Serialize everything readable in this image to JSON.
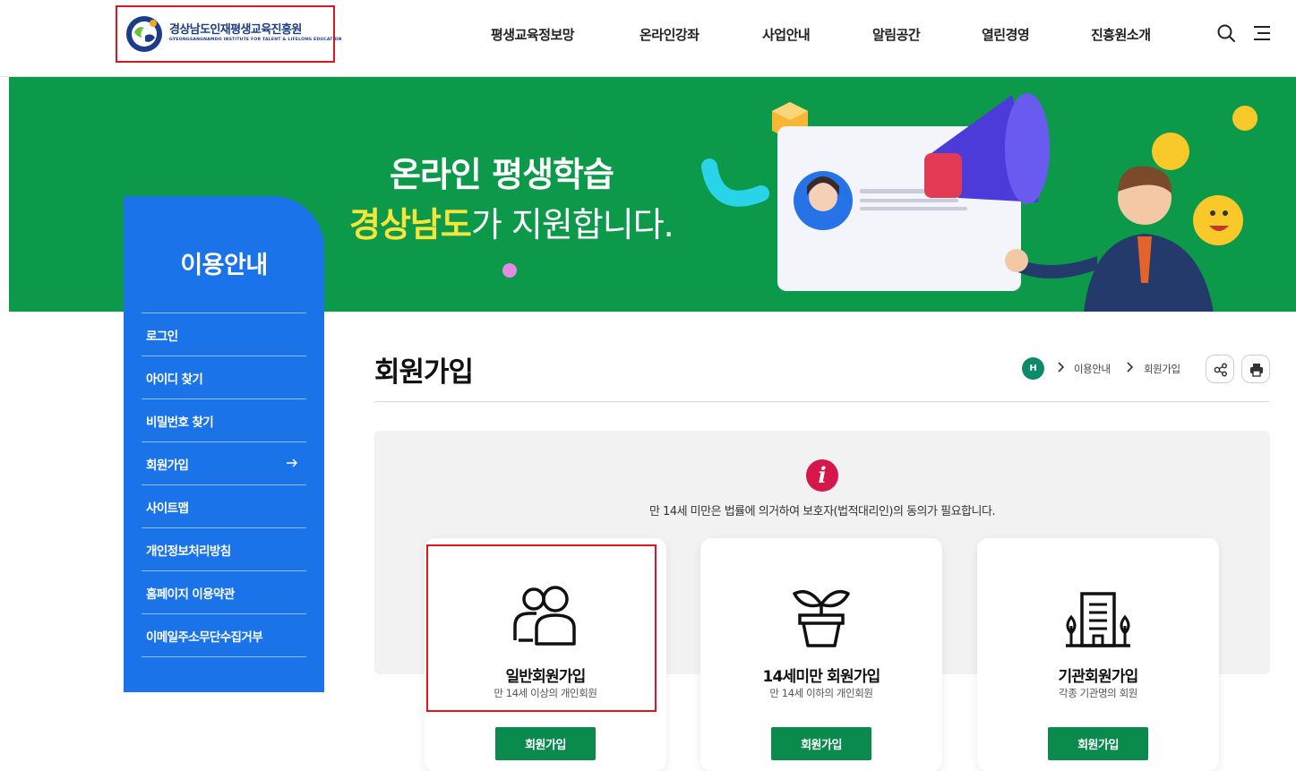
{
  "header": {
    "logo_title": "경상남도인재평생교육진흥원",
    "logo_subtitle": "GYEONGSANGNAMDO INSTITUTE FOR TALENT & LIFELONG EDUCATION",
    "nav": [
      "평생교육정보망",
      "온라인강좌",
      "사업안내",
      "알림공간",
      "열린경영",
      "진흥원소개"
    ],
    "search_icon": "search-icon",
    "menu_icon": "hamburger-menu-icon"
  },
  "banner": {
    "line1": "온라인 평생학습",
    "line2_highlight": "경상남도",
    "line2_rest": "가 지원합니다."
  },
  "sidebar": {
    "title": "이용안내",
    "items": [
      {
        "label": "로그인"
      },
      {
        "label": "아이디 찾기"
      },
      {
        "label": "비밀번호 찾기"
      },
      {
        "label": "회원가입",
        "active": true
      },
      {
        "label": "사이트맵"
      },
      {
        "label": "개인정보처리방침"
      },
      {
        "label": "홈페이지 이용약관"
      },
      {
        "label": "이메일주소무단수집거부"
      }
    ]
  },
  "content": {
    "page_title": "회원가입",
    "breadcrumb": {
      "home": "H",
      "level1": "이용안내",
      "level2": "회원가입"
    },
    "notice": "만 14세 미만은 법률에 의거하여 보호자(법적대리인)의 동의가 필요합니다.",
    "cards": [
      {
        "title": "일반회원가입",
        "subtitle": "만 14세 이상의 개인회원",
        "button": "회원가입",
        "icon": "people-icon"
      },
      {
        "title": "14세미만 회원가입",
        "subtitle": "만 14세 이하의 개인회원",
        "button": "회원가입",
        "icon": "sprout-pot-icon"
      },
      {
        "title": "기관회원가입",
        "subtitle": "각종 기관명의 회원",
        "button": "회원가입",
        "icon": "building-trees-icon"
      }
    ]
  },
  "colors": {
    "brand_green": "#0c9a4a",
    "sidebar_blue": "#1a73e8",
    "button_green": "#0a8a4d",
    "info_red": "#d6174a",
    "highlight_red": "#e0151d"
  }
}
